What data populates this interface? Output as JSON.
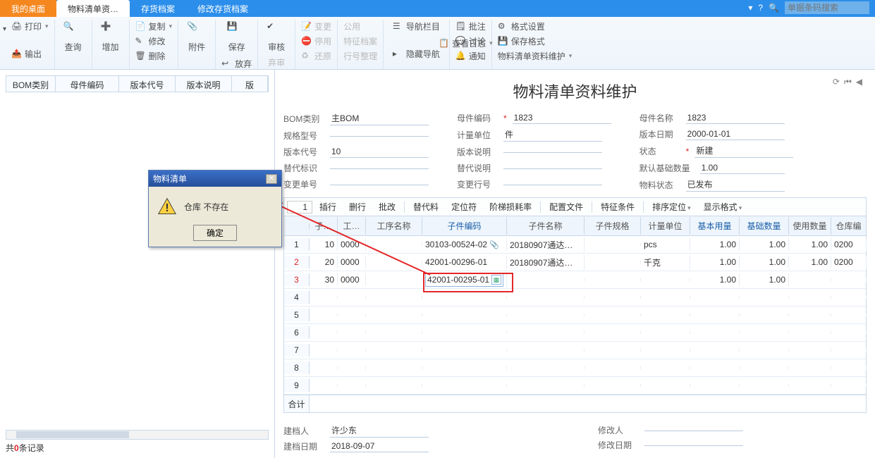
{
  "tabs": {
    "desktop": "我的桌面",
    "active": "物料清单资…",
    "inventory": "存货档案",
    "modify_inventory": "修改存货档案"
  },
  "search": {
    "placeholder": "单据条码搜索"
  },
  "ribbon": {
    "print": "打印",
    "output": "输出",
    "query": "查询",
    "add": "增加",
    "copy": "复制",
    "modify": "修改",
    "delete": "删除",
    "attachment": "附件",
    "save": "保存",
    "discard": "放弃",
    "audit": "审核",
    "abandon": "弃审",
    "change": "变更",
    "stop": "停用",
    "restore": "还原",
    "public": "公用",
    "feature_file": "特征档案",
    "line_cleanup": "行号整理",
    "nav_bar": "导航栏目",
    "view_log": "查看日志",
    "hide_nav": "隐藏导航",
    "comment": "批注",
    "discuss": "讨论",
    "notify": "通知",
    "format_setting": "格式设置",
    "save_format": "保存格式",
    "maintain": "物料清单资料维护"
  },
  "left_grid": {
    "headers": [
      "BOM类别",
      "母件编码",
      "版本代号",
      "版本说明",
      "版"
    ],
    "footer_prefix": "共",
    "footer_count": "0",
    "footer_suffix": "条记录"
  },
  "page_title": "物料清单资料维护",
  "form": {
    "bom_type": {
      "label": "BOM类别",
      "value": "主BOM"
    },
    "spec": {
      "label": "规格型号",
      "value": ""
    },
    "version_code": {
      "label": "版本代号",
      "value": "10"
    },
    "replace_flag": {
      "label": "替代标识",
      "value": ""
    },
    "change_no": {
      "label": "变更单号",
      "value": ""
    },
    "parent_code": {
      "label": "母件编码",
      "req": true,
      "value": "1823"
    },
    "unit": {
      "label": "计量单位",
      "value": "件"
    },
    "version_desc": {
      "label": "版本说明",
      "value": ""
    },
    "replace_desc": {
      "label": "替代说明",
      "value": ""
    },
    "change_line": {
      "label": "变更行号",
      "value": ""
    },
    "parent_name": {
      "label": "母件名称",
      "value": "1823"
    },
    "version_date": {
      "label": "版本日期",
      "value": "2000-01-01"
    },
    "status": {
      "label": "状态",
      "req": true,
      "value": "新建"
    },
    "default_base_qty": {
      "label": "默认基础数量",
      "value": "1.00"
    },
    "material_status": {
      "label": "物料状态",
      "value": "已发布"
    }
  },
  "actions": {
    "insert": "插行",
    "delrow": "删行",
    "batch": "批改",
    "alt_mat": "替代料",
    "locator": "定位符",
    "step_loss": "阶梯损耗率",
    "config_file": "配置文件",
    "feature_cond": "特征条件",
    "sort_locate": "排序定位",
    "display_mode": "显示格式",
    "rownum_value": "1"
  },
  "table": {
    "headers": [
      "",
      "子…",
      "工…",
      "工序名称",
      "子件编码",
      "子件名称",
      "子件规格",
      "计量单位",
      "基本用量",
      "基础数量",
      "使用数量",
      "仓库编"
    ],
    "rows": [
      {
        "n": "1",
        "sub": "10",
        "proc": "0000",
        "code": "30103-00524-02",
        "clip": true,
        "name": "20180907通达…",
        "unit": "pcs",
        "base": "1.00",
        "baseq": "1.00",
        "useq": "1.00",
        "wh": "0200"
      },
      {
        "n": "2",
        "red": true,
        "sub": "20",
        "proc": "0000",
        "code": "42001-00296-01",
        "name": "20180907通达…",
        "unit": "千克",
        "base": "1.00",
        "baseq": "1.00",
        "useq": "1.00",
        "wh": "0200"
      },
      {
        "n": "3",
        "red": true,
        "sub": "30",
        "proc": "0000",
        "code": "42001-00295-01",
        "lookup": true,
        "name": "",
        "unit": "",
        "base": "1.00",
        "baseq": "1.00",
        "useq": "",
        "wh": ""
      },
      {
        "n": "4"
      },
      {
        "n": "5"
      },
      {
        "n": "6"
      },
      {
        "n": "7"
      },
      {
        "n": "8"
      },
      {
        "n": "9"
      }
    ],
    "footer_label": "合计"
  },
  "bottom": {
    "creator": {
      "label": "建档人",
      "value": "许少东"
    },
    "create_date": {
      "label": "建档日期",
      "value": "2018-09-07"
    },
    "modifier": {
      "label": "修改人",
      "value": ""
    },
    "modify_date": {
      "label": "修改日期",
      "value": ""
    }
  },
  "dialog": {
    "title": "物料清单",
    "message": "仓库  不存在",
    "ok": "确定"
  }
}
